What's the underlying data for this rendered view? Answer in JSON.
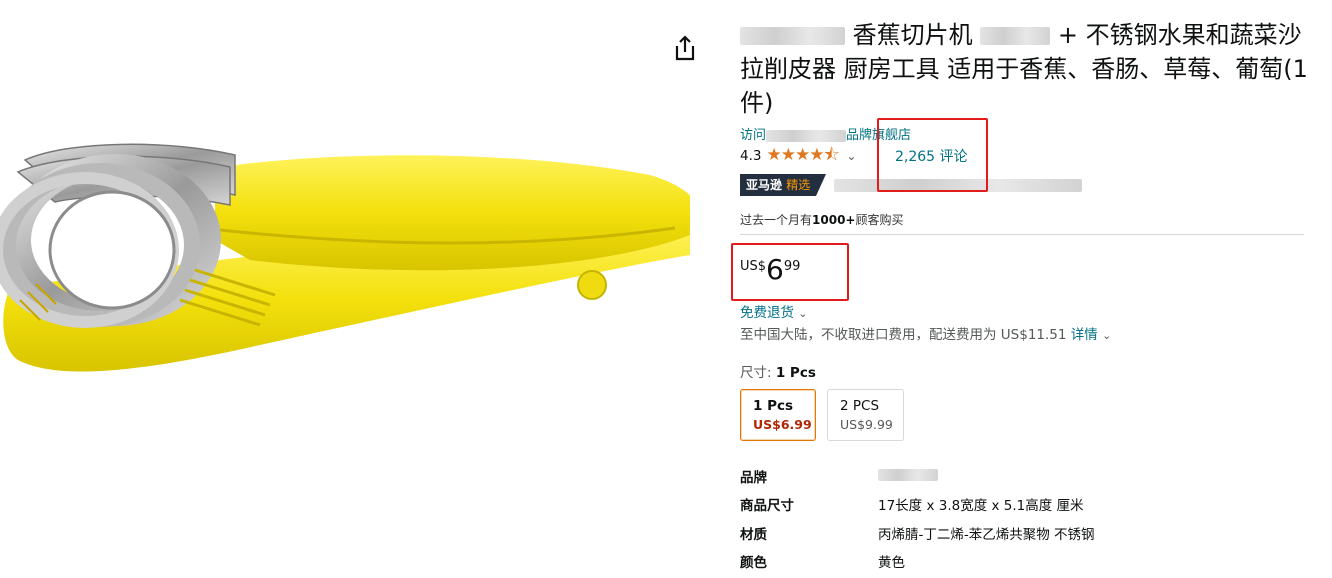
{
  "product": {
    "title_prefix_hidden": "",
    "title_part1": "香蕉切片机",
    "title_part2": "+ 不锈钢水果和蔬菜沙拉削皮器 厨房工具 适用于香蕉、香肠、草莓、葡萄(1 件)",
    "image_alt": "banana-slicer"
  },
  "store": {
    "prefix": "访问",
    "suffix": "品牌旗舰店"
  },
  "rating": {
    "value": "4.3",
    "stars": "★★★★⯪",
    "count_text": "2,265 评论"
  },
  "badge": {
    "brand": "亚马逊",
    "accent": "精选"
  },
  "bought": {
    "prefix": "过去一个月有",
    "count": "1000+",
    "suffix": "顾客购买"
  },
  "price": {
    "currency": "US$",
    "whole": "6",
    "fraction": "99"
  },
  "returns": {
    "label": "免费退货",
    "chevron": "⌄"
  },
  "shipping": {
    "text": "至中国大陆，不收取进口费用，配送费用为 US$11.51",
    "details_label": "详情",
    "chevron": "⌄"
  },
  "size": {
    "label": "尺寸: ",
    "selected": "1 Pcs",
    "options": [
      {
        "name": "1 Pcs",
        "price": "US$6.99"
      },
      {
        "name": "2 PCS",
        "price": "US$9.99"
      }
    ]
  },
  "specs": [
    {
      "key": "品牌",
      "value": ""
    },
    {
      "key": "商品尺寸",
      "value": "17长度 x 3.8宽度 x 5.1高度 厘米"
    },
    {
      "key": "材质",
      "value": "丙烯腈-丁二烯-苯乙烯共聚物 不锈钢"
    },
    {
      "key": "颜色",
      "value": "黄色"
    }
  ],
  "colors": {
    "link": "#007185",
    "star": "#de7921",
    "deal_price": "#b12704",
    "badge_bg": "#232f3e",
    "badge_accent": "#ff9900",
    "highlight_box": "#e31b1b",
    "product_yellow": "#f5e30f"
  },
  "icons": {
    "share": "share-icon",
    "rating_dropdown": "chevron-down-icon"
  }
}
